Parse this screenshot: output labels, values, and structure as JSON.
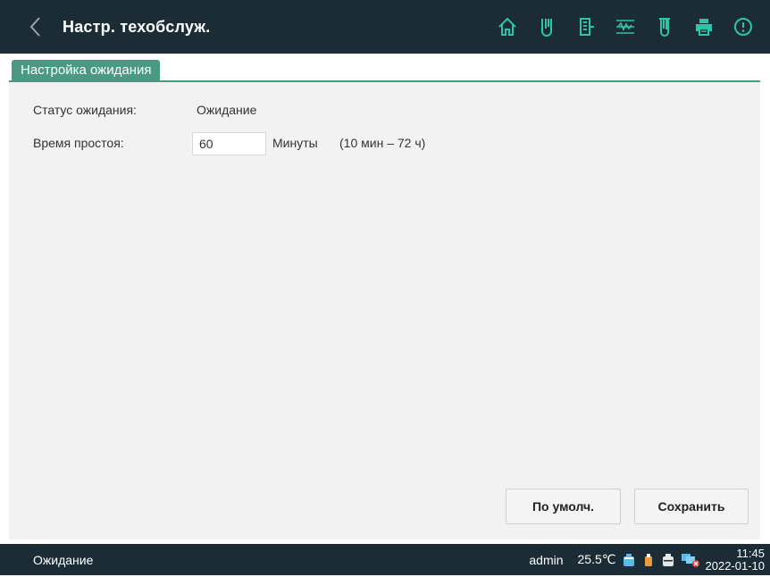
{
  "header": {
    "title": "Настр. техобслуж.",
    "back_icon": "chevron-left-icon",
    "toolbar": [
      "home-icon",
      "test-tube-icon",
      "exit-door-icon",
      "waveform-icon",
      "tube-dropper-icon",
      "printer-icon",
      "alert-circle-icon"
    ],
    "accent": "#2ec4a8"
  },
  "tab": {
    "label": "Настройка ожидания"
  },
  "form": {
    "status_label": "Статус ожидания:",
    "status_value": "Ожидание",
    "idle_label": "Время простоя:",
    "idle_value": "60",
    "unit": "Минуты",
    "range": "(10 мин – 72 ч)"
  },
  "buttons": {
    "default_label": "По умолч.",
    "save_label": "Сохранить"
  },
  "statusbar": {
    "status": "Ожидание",
    "user": "admin",
    "temperature": "25.5℃",
    "time": "11:45",
    "date": "2022-01-10"
  }
}
